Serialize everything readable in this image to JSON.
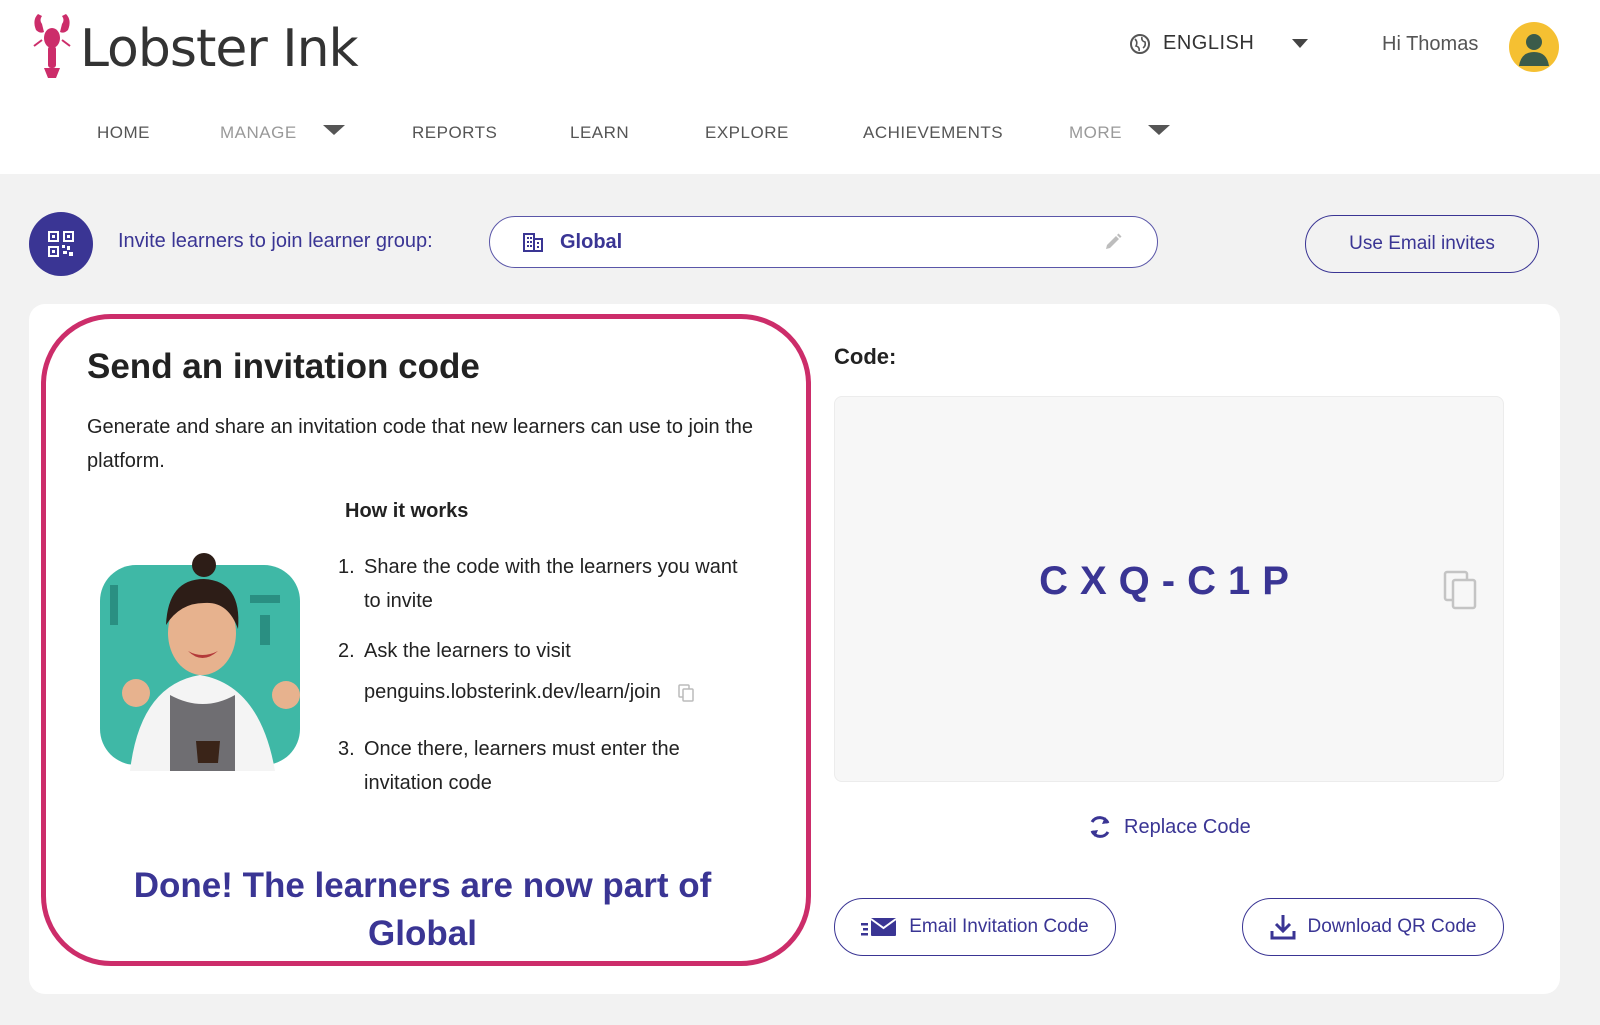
{
  "brand": {
    "name": "Lobster Ink",
    "accent": "#3a3594",
    "highlight": "#cc2d6a",
    "logo_color": "#cc2d6a"
  },
  "header": {
    "language": "ENGLISH",
    "language_icon": "globe-icon",
    "greeting": "Hi Thomas",
    "avatar_icon": "user-avatar-icon"
  },
  "nav": {
    "items": [
      {
        "label": "HOME",
        "dropdown": false
      },
      {
        "label": "MANAGE",
        "dropdown": true
      },
      {
        "label": "REPORTS",
        "dropdown": false
      },
      {
        "label": "LEARN",
        "dropdown": false
      },
      {
        "label": "EXPLORE",
        "dropdown": false
      },
      {
        "label": "ACHIEVEMENTS",
        "dropdown": false
      },
      {
        "label": "MORE",
        "dropdown": true
      }
    ]
  },
  "invite": {
    "label": "Invite learners to join learner group:",
    "group": "Global",
    "use_email_invites": "Use Email invites"
  },
  "left": {
    "title": "Send an invitation code",
    "description": "Generate and share an invitation code that new learners can use to join the platform.",
    "how_title": "How it works",
    "steps": [
      {
        "num": "1.",
        "text": "Share the code with the learners you want to invite"
      },
      {
        "num": "2.",
        "text": "Ask the learners to visit",
        "link": "penguins.lobsterink.dev/learn/join"
      },
      {
        "num": "3.",
        "text": "Once there, learners must enter the invitation code"
      }
    ],
    "done": "Done! The learners are now part of Global"
  },
  "right": {
    "code_label": "Code:",
    "code": "CXQ-C1P",
    "replace_label": "Replace Code",
    "email_code_label": "Email Invitation Code",
    "download_qr_label": "Download QR Code"
  }
}
